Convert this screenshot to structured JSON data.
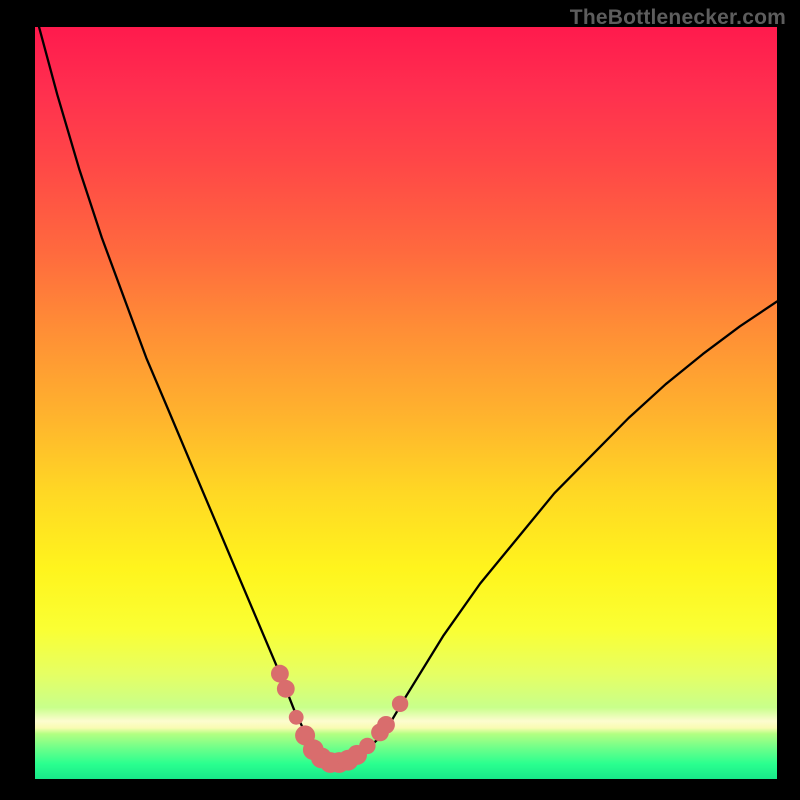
{
  "attribution": "TheBottlenecker.com",
  "chart_data": {
    "type": "line",
    "title": "",
    "xlabel": "",
    "ylabel": "",
    "xlim": [
      0,
      100
    ],
    "ylim": [
      0,
      100
    ],
    "series": [
      {
        "name": "bottleneck-curve",
        "x": [
          0,
          3,
          6,
          9,
          12,
          15,
          18,
          21,
          24,
          27,
          30,
          33,
          35,
          37,
          38.5,
          40,
          42,
          44,
          47,
          50,
          55,
          60,
          65,
          70,
          75,
          80,
          85,
          90,
          95,
          100
        ],
        "y": [
          102,
          91,
          81,
          72,
          64,
          56,
          49,
          42,
          35,
          28,
          21,
          14,
          9,
          5,
          3,
          2.2,
          2.2,
          3.3,
          6,
          11,
          19,
          26,
          32,
          38,
          43,
          48,
          52.5,
          56.5,
          60.2,
          63.5
        ]
      }
    ],
    "markers": {
      "name": "curve-markers",
      "color": "#d96d6d",
      "points": [
        {
          "x": 33.0,
          "y": 14.0,
          "r": 1.2
        },
        {
          "x": 33.8,
          "y": 12.0,
          "r": 1.2
        },
        {
          "x": 35.2,
          "y": 8.2,
          "r": 1.0
        },
        {
          "x": 36.4,
          "y": 5.8,
          "r": 1.35
        },
        {
          "x": 37.5,
          "y": 3.9,
          "r": 1.4
        },
        {
          "x": 38.6,
          "y": 2.8,
          "r": 1.4
        },
        {
          "x": 39.8,
          "y": 2.2,
          "r": 1.4
        },
        {
          "x": 41.0,
          "y": 2.2,
          "r": 1.4
        },
        {
          "x": 42.2,
          "y": 2.5,
          "r": 1.4
        },
        {
          "x": 43.4,
          "y": 3.2,
          "r": 1.35
        },
        {
          "x": 44.8,
          "y": 4.4,
          "r": 1.1
        },
        {
          "x": 46.5,
          "y": 6.2,
          "r": 1.2
        },
        {
          "x": 47.3,
          "y": 7.2,
          "r": 1.2
        },
        {
          "x": 49.2,
          "y": 10.0,
          "r": 1.1
        }
      ]
    }
  }
}
